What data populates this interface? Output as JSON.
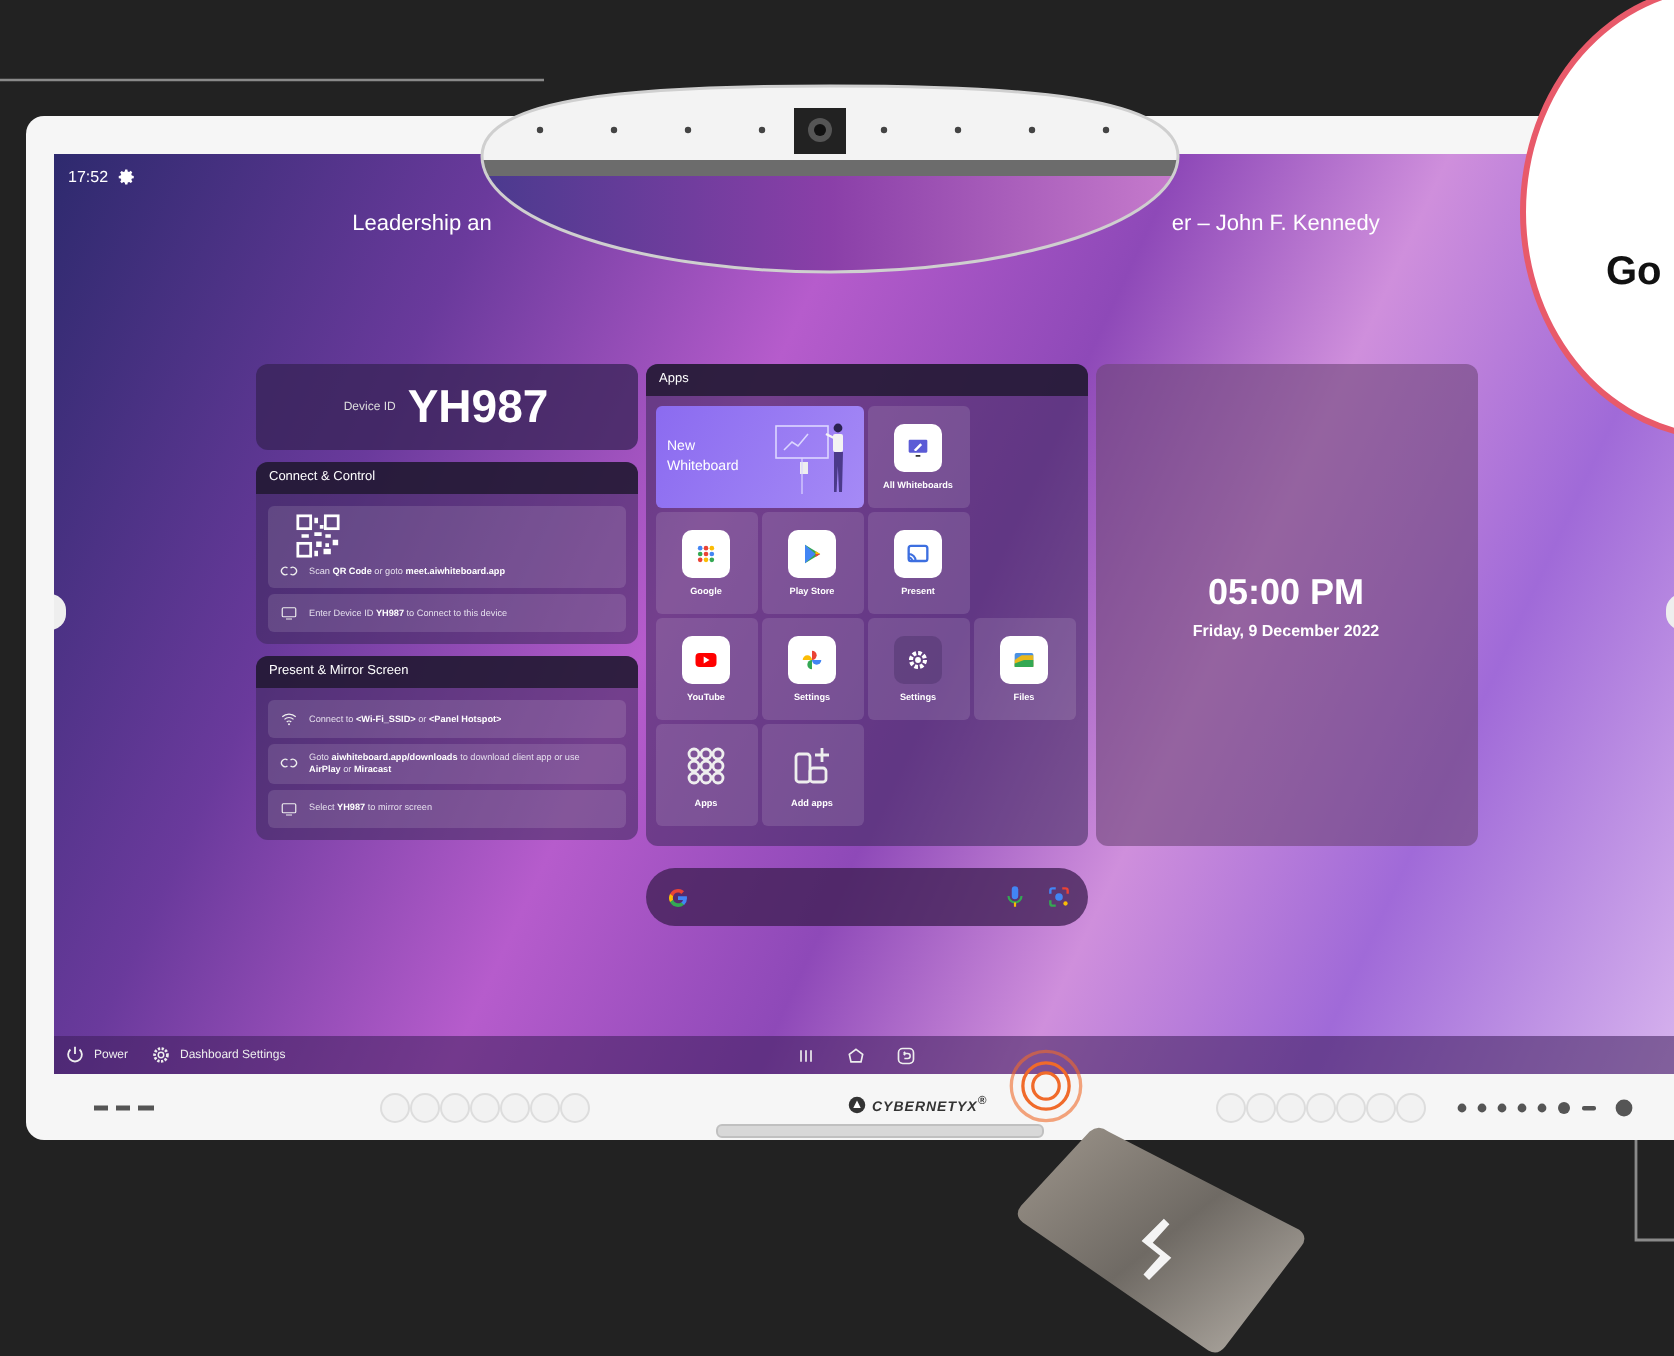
{
  "status": {
    "time": "17:52"
  },
  "quote": {
    "left": "Leadership an",
    "right": "er – John F. Kennedy"
  },
  "device": {
    "label": "Device ID",
    "id": "YH987"
  },
  "connect": {
    "title": "Connect & Control",
    "items": [
      {
        "kind": "qr",
        "text": "Scan **QR Code** or goto **meet.aiwhiteboard.app**"
      },
      {
        "kind": "screen",
        "text": "Enter Device ID **YH987** to Connect to this device"
      }
    ]
  },
  "present": {
    "title": "Present & Mirror Screen",
    "items": [
      {
        "kind": "wifi",
        "text": "Connect to **<Wi-Fi_SSID>** or **<Panel Hotspot>**"
      },
      {
        "kind": "link",
        "text": "Goto **aiwhiteboard.app/downloads** to download client app or use **AirPlay** or **Miracast**"
      },
      {
        "kind": "screen",
        "text": "Select **YH987** to mirror screen"
      }
    ]
  },
  "apps": {
    "title": "Apps",
    "rows": [
      [
        {
          "kind": "feature",
          "label": "New Whiteboard"
        },
        "",
        {
          "kind": "whiteboards",
          "label": "All Whiteboards"
        }
      ],
      [
        {
          "kind": "google",
          "label": "Google"
        },
        {
          "kind": "playstore",
          "label": "Play Store"
        },
        {
          "kind": "present",
          "label": "Present"
        }
      ],
      [
        {
          "kind": "youtube",
          "label": "YouTube"
        },
        {
          "kind": "photos",
          "label": "Settings"
        },
        {
          "kind": "gear",
          "label": "Settings"
        },
        {
          "kind": "files",
          "label": "Files"
        }
      ],
      [
        {
          "kind": "apps",
          "label": "Apps"
        },
        {
          "kind": "add",
          "label": "Add apps"
        }
      ]
    ]
  },
  "clock": {
    "time": "05:00 PM",
    "date": "Friday, 9 December 2022"
  },
  "taskbar": {
    "items": [
      {
        "kind": "power",
        "label": "Power"
      },
      {
        "kind": "settings",
        "label": "Dashboard Settings"
      }
    ]
  },
  "bezel": {
    "brand": "CYBERNETYX$^{®}$"
  },
  "callout": {
    "text": "Go"
  }
}
